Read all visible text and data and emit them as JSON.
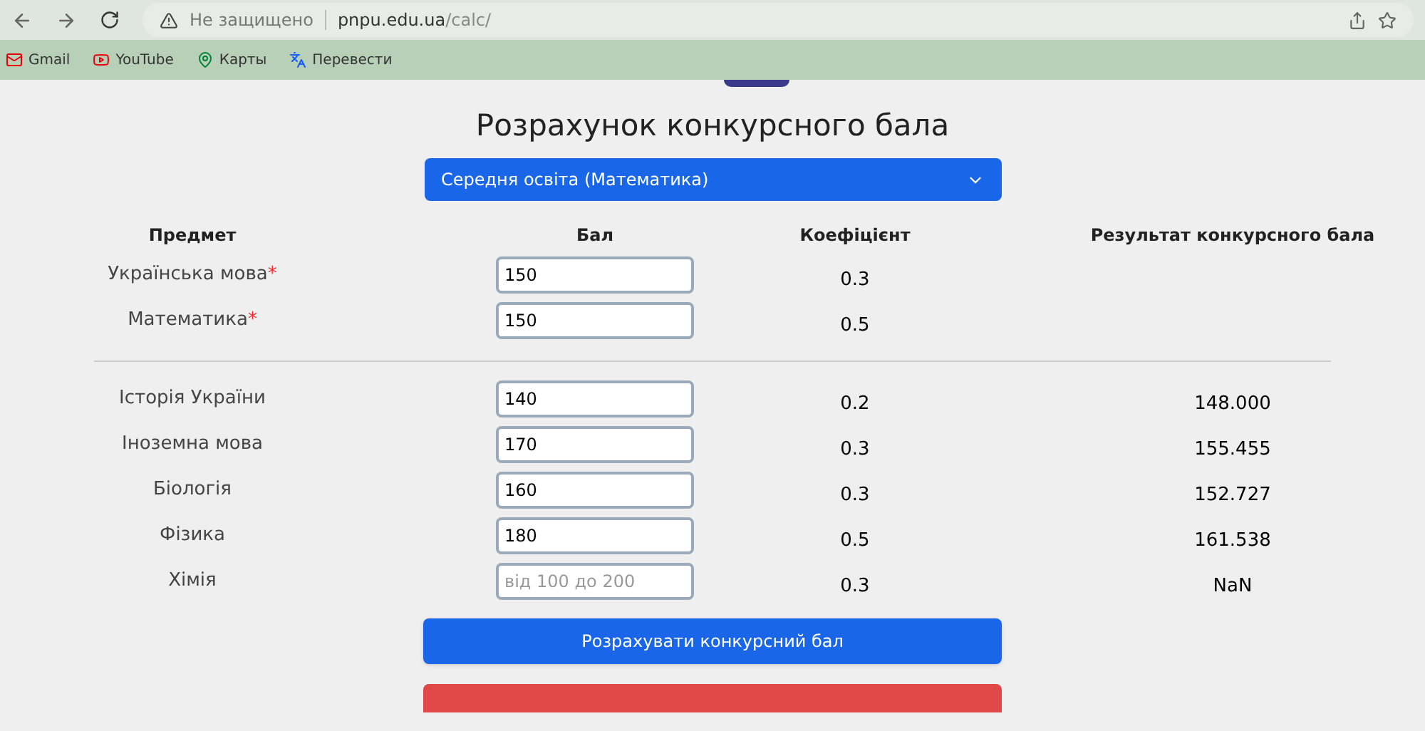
{
  "browser": {
    "security": "Не защищено",
    "url_host": "pnpu.edu.ua",
    "url_path": "/calc/"
  },
  "bookmarks": [
    {
      "label": "Gmail",
      "kind": "mail"
    },
    {
      "label": "YouTube",
      "kind": "video"
    },
    {
      "label": "Карты",
      "kind": "maps"
    },
    {
      "label": "Перевести",
      "kind": "translate"
    }
  ],
  "title": "Розрахунок конкурсного бала",
  "program_select": {
    "value": "Середня освіта (Математика)"
  },
  "table": {
    "columns": [
      "Предмет",
      "Бал",
      "Коефіцієнт",
      "Результат конкурсного бала"
    ],
    "required_rows": [
      {
        "subject": "Українська мова",
        "required_mark": "*",
        "score": "150",
        "coefficient": "0.3"
      },
      {
        "subject": "Математика",
        "required_mark": "*",
        "score": "150",
        "coefficient": "0.5"
      }
    ],
    "optional_rows": [
      {
        "subject": "Історія України",
        "score": "140",
        "coefficient": "0.2",
        "result": "148.000"
      },
      {
        "subject": "Іноземна мова",
        "score": "170",
        "coefficient": "0.3",
        "result": "155.455"
      },
      {
        "subject": "Біологія",
        "score": "160",
        "coefficient": "0.3",
        "result": "152.727"
      },
      {
        "subject": "Фізика",
        "score": "180",
        "coefficient": "0.5",
        "result": "161.538"
      },
      {
        "subject": "Хімія",
        "placeholder": "від 100 до 200",
        "coefficient": "0.3",
        "result": "NaN"
      }
    ]
  },
  "calculate_button": "Розрахувати конкурсний бал"
}
